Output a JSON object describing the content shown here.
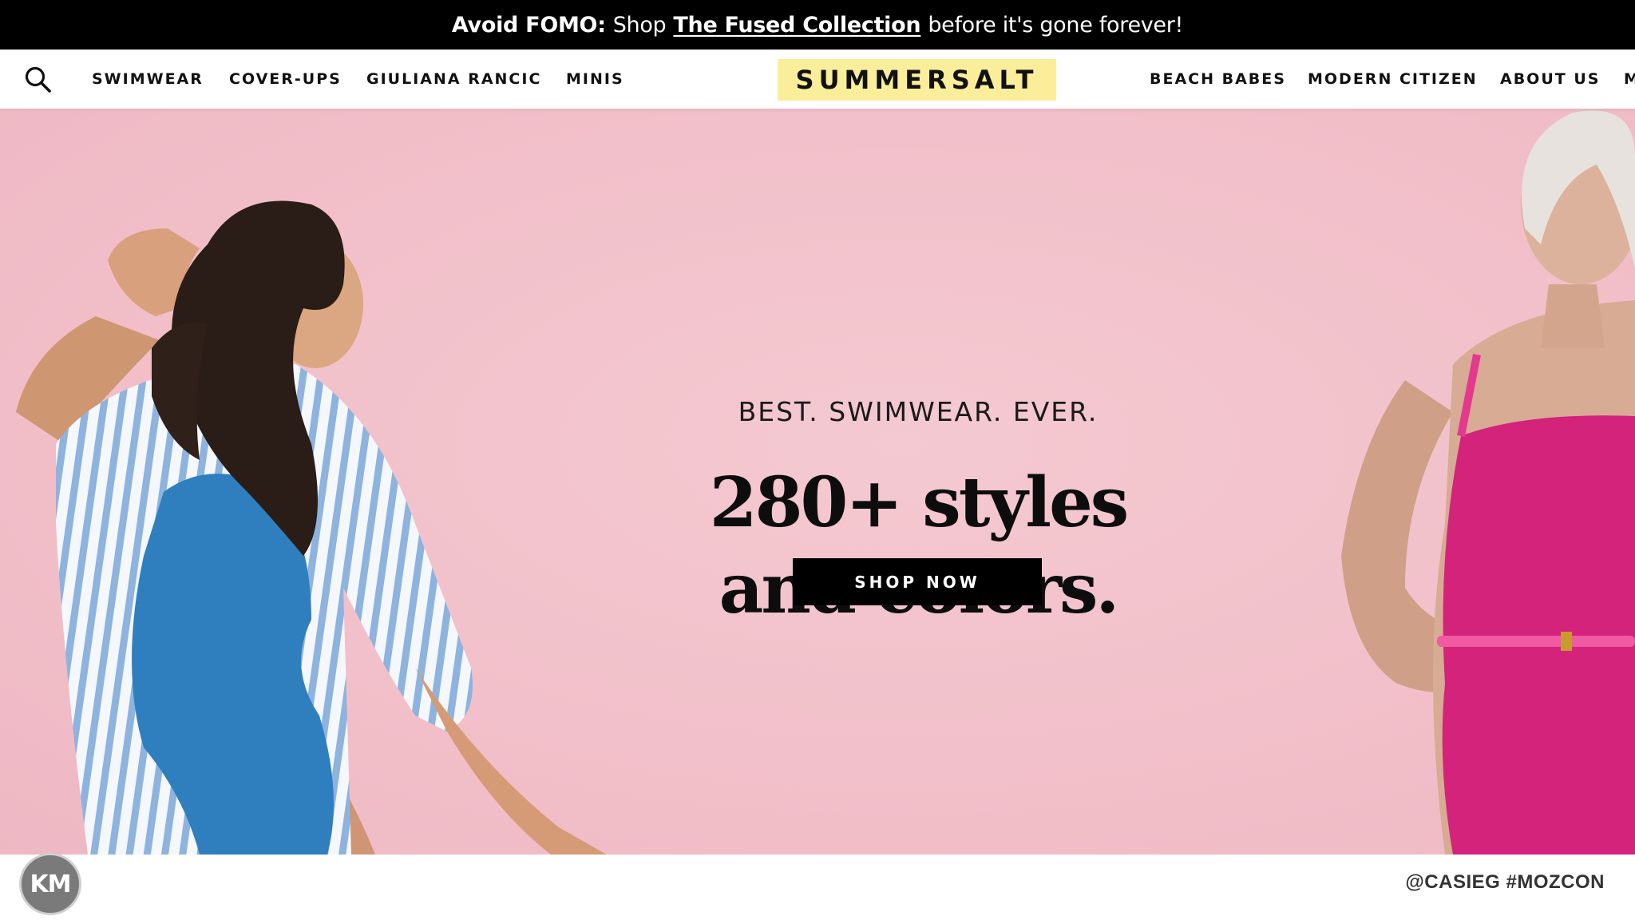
{
  "announcement": {
    "prefix_bold": "Avoid FOMO:",
    "pre_link": "Shop",
    "link_text": "The Fused Collection",
    "suffix": "before it's gone forever!"
  },
  "header": {
    "search_icon": "search-icon",
    "left_nav": [
      "SWIMWEAR",
      "COVER-UPS",
      "GIULIANA RANCIC",
      "MINIS"
    ],
    "logo": "SUMMERSALT",
    "right_nav": [
      "BEACH BABES",
      "MODERN CITIZEN",
      "ABOUT US",
      "M"
    ]
  },
  "hero": {
    "tagline": "BEST. SWIMWEAR. EVER.",
    "headline_line1": "280+ styles",
    "headline_line2": "and colors.",
    "cta_label": "SHOP NOW"
  },
  "footer": {
    "avatar_initials": "KM",
    "handle": "@CASIEG #MOZCON"
  },
  "colors": {
    "announcement_bg": "#000000",
    "logo_bg": "#fbee9a",
    "hero_bg": "#f2c0ca",
    "cta_bg": "#000000",
    "swimsuit_blue": "#2f7fbf",
    "swimsuit_magenta": "#d4237a"
  }
}
